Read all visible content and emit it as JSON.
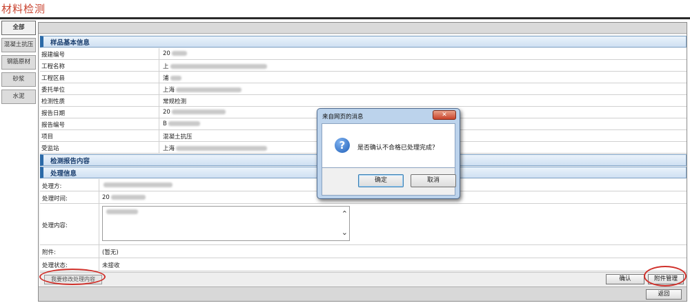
{
  "app": {
    "title": "材料检测"
  },
  "sidebar": {
    "tabs": [
      {
        "label": "全部",
        "active": true
      },
      {
        "label": "混凝土抗压",
        "active": false
      },
      {
        "label": "钢筋原材",
        "active": false
      },
      {
        "label": "砂浆",
        "active": false
      },
      {
        "label": "水泥",
        "active": false
      }
    ]
  },
  "sections": {
    "basic": "样品基本信息",
    "report": "检测报告内容",
    "process": "处理信息"
  },
  "basic_info": [
    {
      "label": "报建编号",
      "value": "20"
    },
    {
      "label": "工程名称",
      "value": "上"
    },
    {
      "label": "工程区县",
      "value": "浦"
    },
    {
      "label": "委托单位",
      "value": "上海"
    },
    {
      "label": "检测性质",
      "value": "常规检测"
    },
    {
      "label": "报告日期",
      "value": "20"
    },
    {
      "label": "报告编号",
      "value": "B"
    },
    {
      "label": "项目",
      "value": "混凝土抗压"
    },
    {
      "label": "受监站",
      "value": "上海"
    }
  ],
  "process_info": {
    "handler_label": "处理方:",
    "time_label": "处理时间:",
    "time_value": "20",
    "content_label": "处理内容:",
    "attachment_label": "附件:",
    "attachment_value": "(暂无)",
    "status_label": "处理状态:",
    "status_value": "未接收"
  },
  "actions": {
    "modify_label": "我要修改处理内容",
    "confirm_label": "确认",
    "attach_label": "附件管理",
    "back_label": "返回"
  },
  "dialog": {
    "title": "来自网页的消息",
    "close_glyph": "✕",
    "icon_glyph": "?",
    "message": "是否确认不合格已处理完成？",
    "ok_label": "确定",
    "cancel_label": "取消"
  },
  "colors": {
    "title_red": "#c8412d",
    "section_blue": "#2b6aa8",
    "annotation_red": "#d0302a"
  }
}
